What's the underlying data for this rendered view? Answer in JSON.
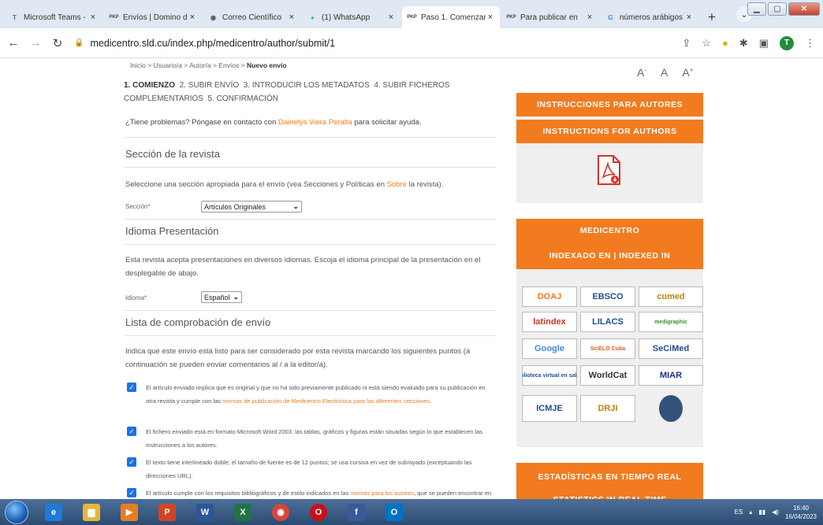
{
  "browser": {
    "tabs": [
      {
        "title": "Microsoft Teams -",
        "icon": "teams-icon",
        "icon_char": "T",
        "color": "#5059c9",
        "active": false
      },
      {
        "title": "Envíos | Domino d",
        "icon": "pkp-icon",
        "icon_char": "PKP",
        "color": "#444444",
        "active": false
      },
      {
        "title": "Correo Científico",
        "icon": "mail-icon",
        "icon_char": "◉",
        "color": "#555555",
        "active": false
      },
      {
        "title": "(1) WhatsApp",
        "icon": "whatsapp-icon",
        "icon_char": "●",
        "color": "#25d366",
        "active": false
      },
      {
        "title": "Paso 1. Comenzar",
        "icon": "pkp-icon",
        "icon_char": "PKP",
        "color": "#444444",
        "active": true
      },
      {
        "title": "Para publicar en",
        "icon": "pkp-icon",
        "icon_char": "PKP",
        "color": "#444444",
        "active": false
      },
      {
        "title": "números arábigos",
        "icon": "google-icon",
        "icon_char": "G",
        "color": "#4285f4",
        "active": false
      }
    ],
    "new_tab": "+",
    "url": "medicentro.sld.cu/index.php/medicentro/author/submit/1",
    "profile_initial": "T"
  },
  "breadcrumb": {
    "home": "Inicio",
    "user": "Usuario/a",
    "author": "Autor/a",
    "submissions": "Envíos",
    "current": "Nuevo envío",
    "sep": ">"
  },
  "steps": {
    "s1": "1. COMIENZO",
    "s2": "2. SUBIR ENVÍO",
    "s3": "3. INTRODUCIR LOS METADATOS",
    "s4": "4. SUBIR FICHEROS COMPLEMENTARIOS",
    "s5": "5. CONFIRMACIÓN"
  },
  "help": {
    "before": "¿Tiene problemas? Póngase en contacto con ",
    "contact": "Dainelys Viera Peralta",
    "after": " para solicitar ayuda."
  },
  "section": {
    "heading": "Sección de la revista",
    "text_before": "Seleccione una sección apropiada para el envío (vea Secciones y Políticas en ",
    "link": "Sobre",
    "text_after": " la revista).",
    "label": "Sección*",
    "value": "Artículos Originales"
  },
  "language": {
    "heading": "Idioma Presentación",
    "text": "Esta revista acepta presentaciones en diversos idiomas. Escoja el idioma principal de la presentación en el desplegable de abajo.",
    "label": "Idioma*",
    "value": "Español"
  },
  "checklist": {
    "heading": "Lista de comprobación de envío",
    "intro": "Indica que este envío está listo para ser considerado por esta revista marcando los siguientes puntos (a continuación se pueden enviar comentarios al / a la editor/a).",
    "items": [
      {
        "text": "El artículo enviado implica que es original y que no ha sido previamente publicado ni está siendo evaluado para su publicación en otra revista y cumple con las ",
        "link": "normas de publicación de Medicentro Electrónica para las diferentes secciones",
        "after": ".",
        "checked": true
      },
      {
        "text": "El fichero enviado está en formato Microsoft Word 2003; las tablas, gráficos y figuras están situadas según lo que establecen las instrucciones a los autores.",
        "link": "",
        "after": "",
        "checked": true
      },
      {
        "text": "El texto tiene interlineado doble; el tamaño de fuente es de 12 puntos; se usa cursiva en vez de subrayado (exceptuando las direcciones URL).",
        "link": "",
        "after": "",
        "checked": true
      },
      {
        "text": "El artículo cumple con los requisitos bibliográficos y de estilo indicados en las ",
        "link": "normas para los autores",
        "after": ", que se pueden encontrar en Acerca de la revista.",
        "checked": true
      }
    ]
  },
  "font_size": {
    "small": "A",
    "normal": "A",
    "large": "A",
    "small_mark": "-",
    "large_mark": "+"
  },
  "sidebar": {
    "instructions_es": "INSTRUCCIONES PARA AUTORES",
    "instructions_en": "INSTRUCTIONS FOR AUTHORS",
    "journal": "MEDICENTRO",
    "indexed": "INDEXADO EN | INDEXED IN",
    "logos": [
      {
        "name": "logo-doaj",
        "label": "DOAJ",
        "color": "#f47b20"
      },
      {
        "name": "logo-ebsco",
        "label": "EBSCO",
        "color": "#1d4f91"
      },
      {
        "name": "logo-cubamed",
        "label": "cumed",
        "color": "#b8860b"
      },
      {
        "name": "logo-latindex",
        "label": "latindex",
        "color": "#c0392b"
      },
      {
        "name": "logo-lilacs",
        "label": "LILACS",
        "color": "#1f4e9a"
      },
      {
        "name": "logo-medigraphic",
        "label": "medigraphic",
        "color": "#3a8f2a"
      },
      {
        "name": "logo-google",
        "label": "Google",
        "color": "#4285f4"
      },
      {
        "name": "logo-scielo",
        "label": "SciELO Cuba",
        "color": "#e05a1c"
      },
      {
        "name": "logo-secimed",
        "label": "SeCiMed",
        "color": "#1f4e9a"
      },
      {
        "name": "logo-bvs",
        "label": "biblioteca virtual en salud",
        "color": "#1f4e9a"
      },
      {
        "name": "logo-worldcat",
        "label": "WorldCat",
        "color": "#333333"
      },
      {
        "name": "logo-miar",
        "label": "MIAR",
        "color": "#1f2f8f"
      },
      {
        "name": "logo-icmje",
        "label": "ICMJE",
        "color": "#1f4e9a"
      },
      {
        "name": "logo-drji",
        "label": "DRJI",
        "color": "#b8860b"
      },
      {
        "name": "logo-seal",
        "label": "",
        "color": "#33507a"
      }
    ],
    "stats_es": "ESTADÍSTICAS EN TIEMPO REAL",
    "stats_en": "STATISTICS IN REAL TIME"
  },
  "taskbar": {
    "apps": [
      {
        "name": "ie-icon",
        "label": "e",
        "color": "#1f7ad8"
      },
      {
        "name": "explorer-icon",
        "label": "▆",
        "color": "#e8b53a"
      },
      {
        "name": "media-player-icon",
        "label": "▶",
        "color": "#e67e22"
      },
      {
        "name": "powerpoint-icon",
        "label": "P",
        "color": "#d04423"
      },
      {
        "name": "word-icon",
        "label": "W",
        "color": "#2b579a"
      },
      {
        "name": "excel-icon",
        "label": "X",
        "color": "#217346"
      },
      {
        "name": "chrome-icon",
        "label": "◉",
        "color": "#db4437"
      },
      {
        "name": "opera-icon",
        "label": "O",
        "color": "#cc0f16"
      },
      {
        "name": "facebook-icon",
        "label": "f",
        "color": "#3b5998"
      },
      {
        "name": "outlook-icon",
        "label": "O",
        "color": "#0072c6"
      }
    ],
    "lang": "ES",
    "time": "16:40",
    "date": "16/04/2023"
  }
}
